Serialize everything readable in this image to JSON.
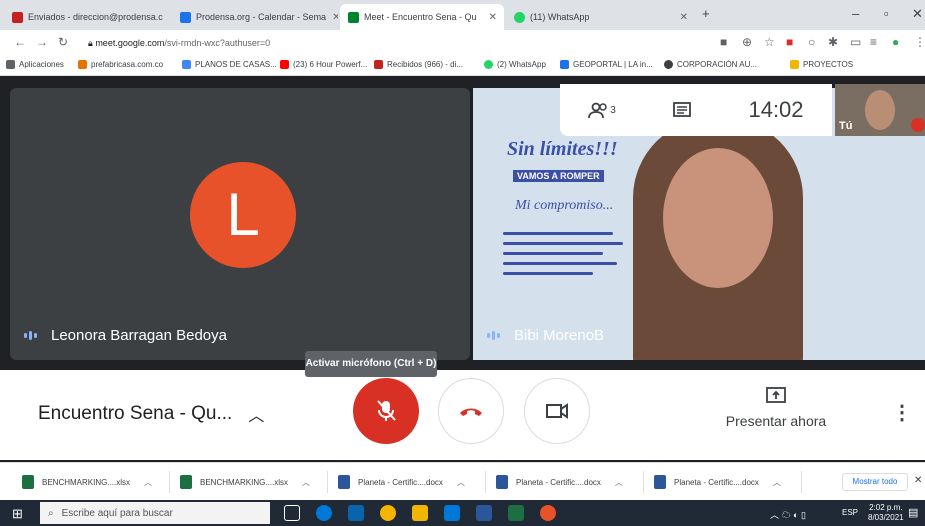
{
  "browser": {
    "tabs": [
      {
        "label": "Enviados - direccion@prodensa.c",
        "color": "#c5221f",
        "active": false
      },
      {
        "label": "Prodensa.org - Calendar - Sema",
        "color": "#1a73e8",
        "active": false
      },
      {
        "label": "Meet - Encuentro Sena - Qu",
        "color": "#00832d",
        "active": true
      },
      {
        "label": "(11) WhatsApp",
        "color": "#25d366",
        "active": false
      }
    ],
    "url_host": "meet.google.com",
    "url_path": "/svi-rmdn-wxc?authuser=0",
    "bookmarks": [
      "Aplicaciones",
      "prefabricasa.com.co",
      "PLANOS DE CASAS...",
      "(23) 6 Hour Powerf...",
      "Recibidos (966) - di...",
      "(2) WhatsApp",
      "GEOPORTAL | LA in...",
      "CORPORACIÓN AU...",
      "PROYECTOS"
    ]
  },
  "meet": {
    "participant_left": {
      "name": "Leonora Barragan Bedoya",
      "initial": "L",
      "avatar_color": "#e8522b"
    },
    "participant_right": {
      "name": "Bibi MorenoB"
    },
    "slide_text": {
      "line1": "Sin límites!!!",
      "line2": "VAMOS A ROMPER",
      "line3": "Mi compromiso..."
    },
    "participants_count": "3",
    "time": "14:02",
    "self_label": "Tú",
    "tooltip": "Activar micrófono (Ctrl + D)",
    "meeting_title": "Encuentro Sena - Qu...",
    "present_label": "Presentar ahora"
  },
  "downloads": {
    "items": [
      "BENCHMARKING....xlsx",
      "BENCHMARKING....xlsx",
      "Planeta - Certific....docx",
      "Planeta - Certific....docx",
      "Planeta - Certific....docx"
    ],
    "show_all": "Mostrar todo"
  },
  "taskbar": {
    "search_placeholder": "Escribe aquí para buscar",
    "lang": "ESP",
    "time": "2:02 p.m.",
    "date": "8/03/2021"
  }
}
